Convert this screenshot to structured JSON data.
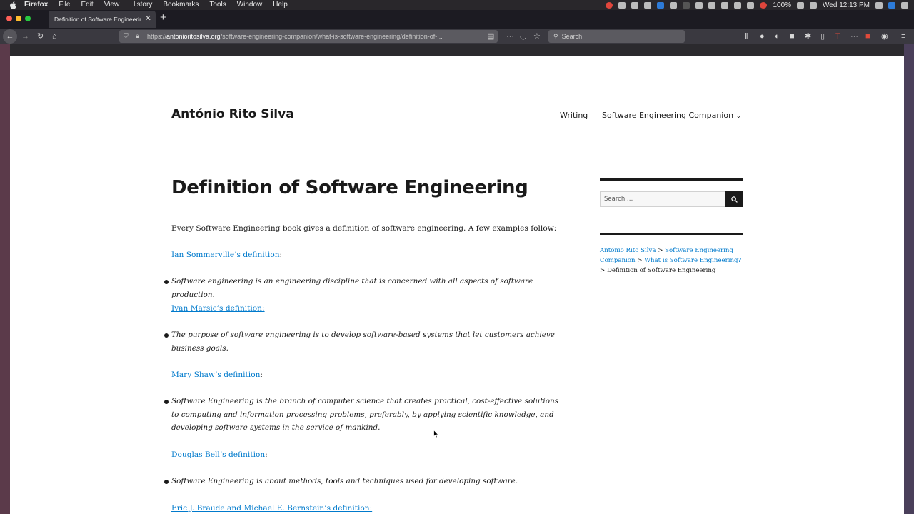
{
  "menubar": {
    "app": "Firefox",
    "items": [
      "File",
      "Edit",
      "View",
      "History",
      "Bookmarks",
      "Tools",
      "Window",
      "Help"
    ],
    "battery": "100%",
    "clock": "Wed 12:13 PM"
  },
  "tab": {
    "title": "Definition of Software Engineering"
  },
  "urlbar": {
    "prefix": "https://",
    "host": "antonioritosilva.org",
    "path": "/software-engineering-companion/what-is-software-engineering/definition-of-..."
  },
  "search": {
    "placeholder": "Search"
  },
  "site": {
    "title": "António Rito Silva",
    "nav": [
      "Writing",
      "Software Engineering Companion"
    ]
  },
  "article": {
    "heading": "Definition of Software Engineering",
    "intro": "Every Software Engineering book gives a definition of software engineering. A few examples follow:",
    "defs": [
      {
        "source": "Ian Sommerville’s definition",
        "quote": "Software engineering is an engineering discipline that is concerned with all aspects of software production."
      },
      {
        "source": "Ivan Marsic’s definition:",
        "quote": "The purpose of software engineering is to develop software-based systems that let customers achieve business goals."
      },
      {
        "source": "Mary Shaw’s definition",
        "quote": "Software Engineering is the branch of computer science that creates practical, cost-effective solutions to computing and information processing problems, preferably, by applying scientific knowledge, and developing software systems in the service of mankind."
      },
      {
        "source": "Douglas Bell’s definition",
        "quote": "Software Engineering is about methods, tools and techniques used for developing software."
      },
      {
        "source": "Eric J. Braude and Michael E. Bernstein’s definition:",
        "quote": ""
      }
    ]
  },
  "sidebar": {
    "search_placeholder": "Search …",
    "breadcrumb": [
      "António Rito Silva",
      "Software Engineering Companion",
      "What is Software Engineering?",
      "Definition of Software Engineering"
    ],
    "separator": ">"
  }
}
